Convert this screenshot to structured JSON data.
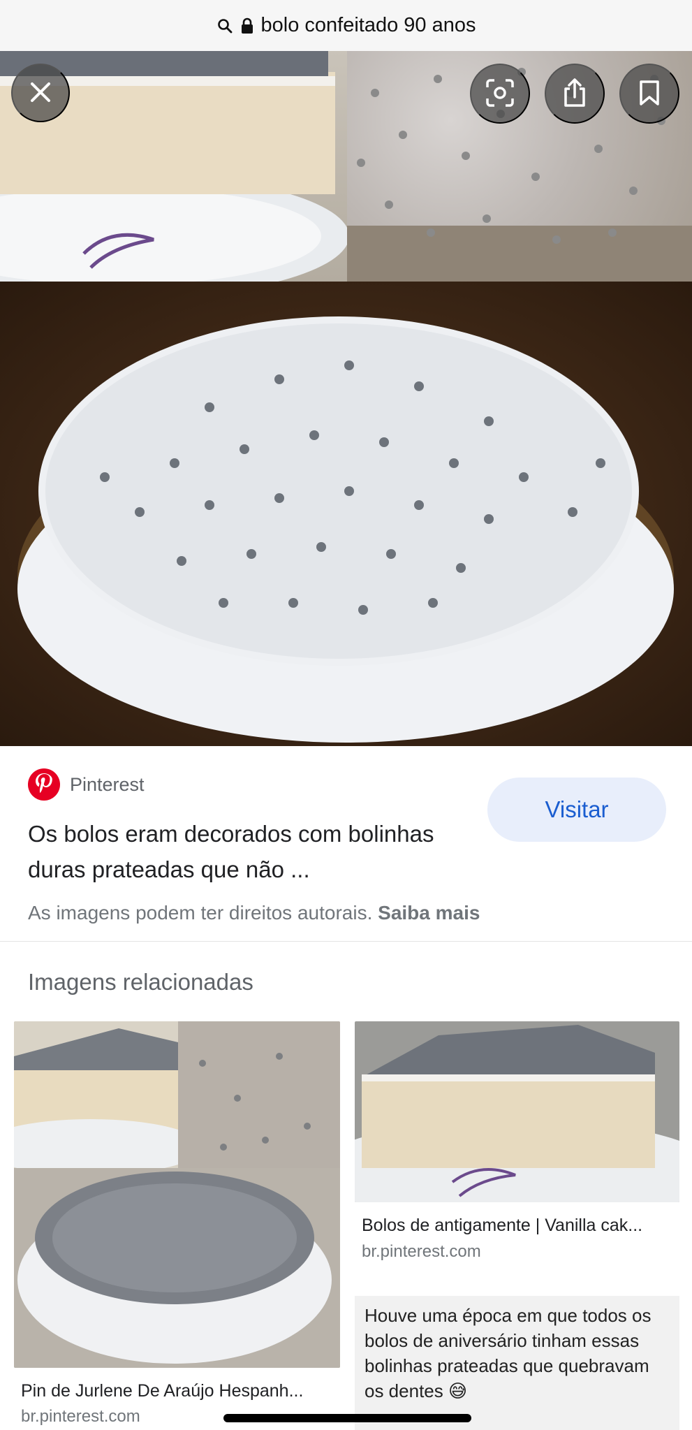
{
  "browser": {
    "url": "bolo confeitado 90 anos",
    "icons": [
      "search-icon",
      "lock-icon"
    ]
  },
  "viewer": {
    "close_icon": "close-icon",
    "lens_icon": "lens-icon",
    "share_icon": "share-icon",
    "save_icon": "bookmark-icon"
  },
  "result": {
    "source": "Pinterest",
    "visit_label": "Visitar",
    "caption": "Os bolos eram decorados com bolinhas duras prateadas que não ...",
    "rights_text": "As imagens podem ter direitos autorais.",
    "rights_link": "Saiba mais"
  },
  "related": {
    "heading": "Imagens relacionadas",
    "items": [
      {
        "title": "Pin de Jurlene De Araújo Hespanh...",
        "domain": "br.pinterest.com"
      },
      {
        "title": "Bolos de antigamente | Vanilla cak...",
        "domain": "br.pinterest.com"
      },
      {
        "title": "Houve uma época em que todos os bolos de aniversário tinham essas bolinhas prateadas que quebravam os dentes",
        "emoji": "😅"
      }
    ]
  },
  "colors": {
    "pinterest_red": "#e60023",
    "visit_bg": "#e8eefb",
    "visit_text": "#1a5dd0",
    "url_bar_bg": "#f6f6f6"
  }
}
